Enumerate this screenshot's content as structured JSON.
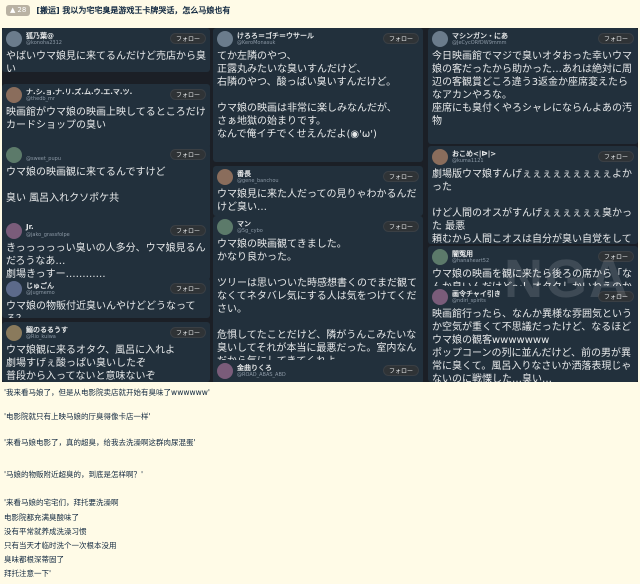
{
  "header": {
    "badge_count": "28",
    "title": "[搬运] 我以为宅宅臭是游戏王卡牌哭话，怎么马娘也有"
  },
  "follow_label": "フォロー",
  "watermark": "NGA",
  "tweets": {
    "c1": [
      {
        "name": "狐乃葉@",
        "handle": "@konoha2312",
        "text": "やばいウマ娘見に来てるんだけど売店から臭い wwwwwwwwwwwwwwwwwwwwwwwwwww"
      },
      {
        "name": "ナ.シ.ョ.ナ.リ.ズ.ム.ウ.エ.マ.ツ.",
        "handle": "@thedb_mr",
        "text": "映画館がウマ娘の映画上映してるところだけカードショップの臭い"
      },
      {
        "name": "",
        "handle": "@sweet_pupu",
        "text": "ウマ娘の映画観に来てるんですけど\n\n臭い 風呂入れクソポケ共"
      },
      {
        "name": "Jr.",
        "handle": "@jako_grassfolpe",
        "text": "きっっっっっい臭いの人多分、ウマ娘見るんだろうなあ…\n劇場きっすー…………"
      },
      {
        "name": "じゅごん",
        "handle": "@Jugmemo",
        "text": "ウマ娘の物販付近臭いんやけどどうなってる？"
      },
      {
        "name": "鰯のるるうす",
        "handle": "@Rio_kuiwa",
        "text": "ウマ娘観に来るオタク、風呂に入れよ\n劇場すげぇ酸っぱい臭いしたぞ\n普段から入ってないと意味ないぞ\n当日だけシャワーしても「詰まってる」からな 気をつけろよ"
      }
    ],
    "c2": [
      {
        "name": "けろろ＝ゴチ＝ウサール",
        "handle": "@KeroMonasuk",
        "text": "てか左隣のやつ、\n正露丸みたいな臭いすんだけど、\n右隣のやつ、酸っぱい臭いすんだけど。\n\nウマ娘の映画は非常に楽しみなんだが、\nさぁ地獄の始まりです。\nなんで俺イチでくせえんだよ(◉'ω')"
      },
      {
        "name": "番長",
        "handle": "@gene_banchou",
        "text": "ウマ娘見に来た人だっての見りゃわかるんだけど臭い…"
      },
      {
        "name": "マン",
        "handle": "@5g_cybo",
        "text": "ウマ娘の映画観てきました。\nかなり良かった。\n\nツリーは思いついた時感想書くのでまだ観てなくてネタバレ気にする人は気をつけてください。\n\n危惧してたことだけど、隣がうんこみたいな臭いしてそれが本当に最悪だった。室内なんだから気にしてきてくれよ。"
      },
      {
        "name": "金曲りくろ",
        "handle": "@ROAD_ABAS_ABD",
        "text": "ウマ娘の映画臭いオタクが多かった\n内容は神だった"
      }
    ],
    "c3": [
      {
        "name": "マシンガン・にあ",
        "handle": "@JeCycORfDW9mmm",
        "text": "今日映画館でマジで臭いオタおった幸いウマ娘の客だったから助かった…あれは絶対に周辺の客観賞どころ違う3返金か座席変えたらなアカンやろな。\n座席にも臭付くやろシャレにならんよあの汚物"
      },
      {
        "name": "おこめ<|ᐅ|>",
        "handle": "@kuma1121",
        "text": "劇場版ウマ娘すんげぇぇぇぇぇぇぇぇぇよかった\n\nけど人間のオスがすんげぇぇぇぇぇぇ臭かった 最悪\n頼むから人間こオスは自分が臭い自覚をしてファブリーズ(無香料)を香水にしろ"
      },
      {
        "name": "闇冤用",
        "handle": "@hanaheart52",
        "text": "ウマ娘の映画を観に来たら後ろの席から「なんか臭いんだけど〜！オタクしかいねえのかよ！」という罵言が劇場に響いた\n確かにこのシアターは臭いぞ"
      },
      {
        "name": "画令チャイ引き",
        "handle": "@ndiri_spirits",
        "text": "映画館行ったら、なんか異様な雰囲気というか空気が重くて不思議だったけど、なるほどウマ娘の観客wwwwwww\nポップコーンの列に並んだけど、前の男が異常に臭くて。風呂入りなさいか洒落表現じゃないのに戦慄した…臭い…"
      }
    ]
  },
  "captions": [
    "'我来看马娘了，但是从电影院卖店就开始有臭味了wwwwww'",
    "'电影院就只有上映马娘的厅臭得像卡店一样'",
    "'来看马娘电影了，真的超臭，给我去洗澡啊这群肉尿混蛋'",
    "'马娘的物贩附近超臭的，到底是怎样啊？'",
    "'来看马娘的宅宅们，拜托要洗澡啊",
    "电影院都充满臭酸味了",
    "没有平常就养成洗澡习惯",
    "只有当天才临时洗个一次根本没用",
    "臭味都根深蒂固了",
    "拜托注意一下'"
  ]
}
